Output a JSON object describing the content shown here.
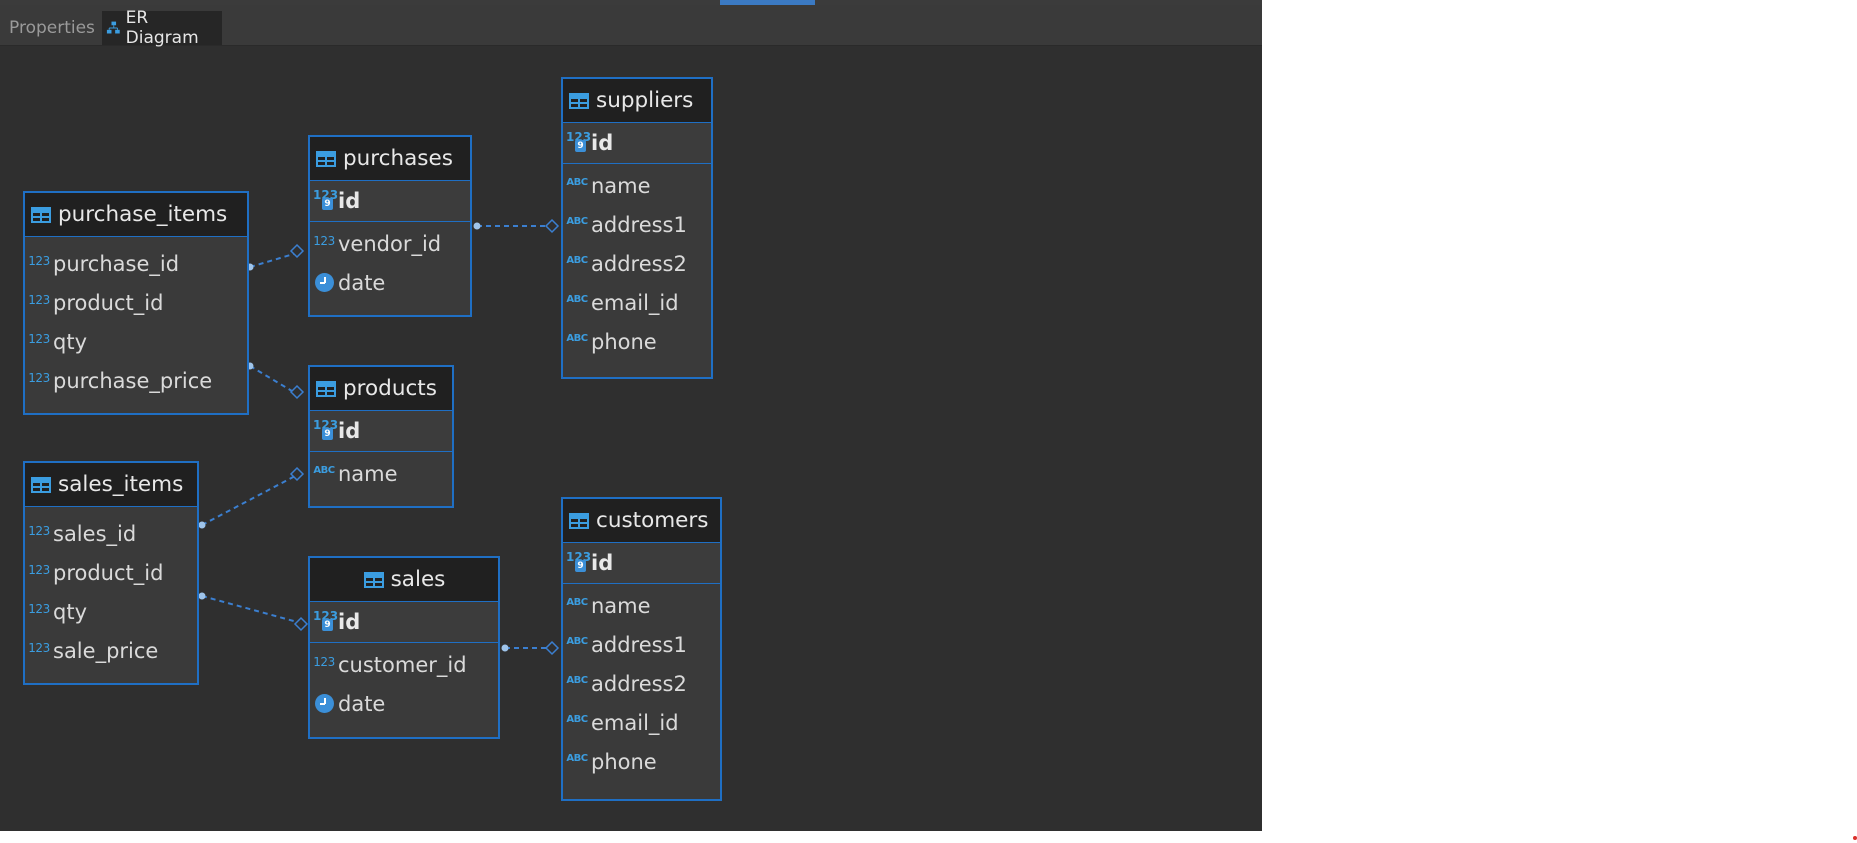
{
  "tabs": [
    {
      "label": "Properties",
      "icon": "properties-icon"
    },
    {
      "label": "ER Diagram",
      "icon": "er-diagram-icon",
      "active": true
    }
  ],
  "entities": {
    "purchase_items": {
      "title": "purchase_items",
      "fields": [
        {
          "name": "purchase_id",
          "type": "123"
        },
        {
          "name": "product_id",
          "type": "123"
        },
        {
          "name": "qty",
          "type": "123"
        },
        {
          "name": "purchase_price",
          "type": "123"
        }
      ]
    },
    "purchases": {
      "title": "purchases",
      "pk": "id",
      "fields": [
        {
          "name": "vendor_id",
          "type": "123"
        },
        {
          "name": "date",
          "type": "clock"
        }
      ]
    },
    "suppliers": {
      "title": "suppliers",
      "pk": "id",
      "fields": [
        {
          "name": "name",
          "type": "abc"
        },
        {
          "name": "address1",
          "type": "abc"
        },
        {
          "name": "address2",
          "type": "abc"
        },
        {
          "name": "email_id",
          "type": "abc"
        },
        {
          "name": "phone",
          "type": "abc"
        }
      ]
    },
    "products": {
      "title": "products",
      "pk": "id",
      "fields": [
        {
          "name": "name",
          "type": "abc"
        }
      ]
    },
    "sales_items": {
      "title": "sales_items",
      "fields": [
        {
          "name": "sales_id",
          "type": "123"
        },
        {
          "name": "product_id",
          "type": "123"
        },
        {
          "name": "qty",
          "type": "123"
        },
        {
          "name": "sale_price",
          "type": "123"
        }
      ]
    },
    "sales": {
      "title": "sales",
      "pk": "id",
      "fields": [
        {
          "name": "customer_id",
          "type": "123"
        },
        {
          "name": "date",
          "type": "clock"
        }
      ]
    },
    "customers": {
      "title": "customers",
      "pk": "id",
      "fields": [
        {
          "name": "name",
          "type": "abc"
        },
        {
          "name": "address1",
          "type": "abc"
        },
        {
          "name": "address2",
          "type": "abc"
        },
        {
          "name": "email_id",
          "type": "abc"
        },
        {
          "name": "phone",
          "type": "abc"
        }
      ]
    }
  },
  "icon_text": {
    "int": "123",
    "text": "ABC",
    "key_badge": "9"
  },
  "colors": {
    "border": "#1f6fc4",
    "link": "#3b7fd0",
    "background": "#2f2f2f"
  }
}
